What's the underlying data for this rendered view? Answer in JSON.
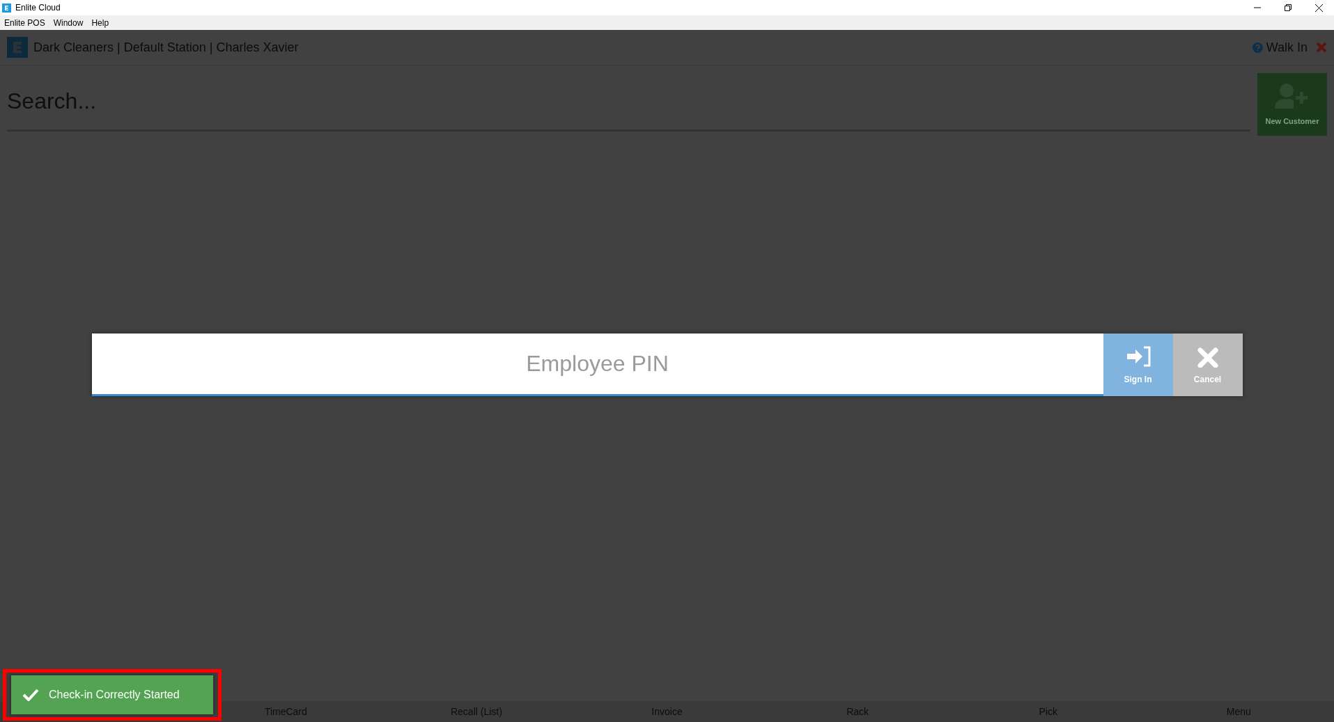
{
  "window": {
    "title": "Enlite Cloud"
  },
  "menu": [
    "Enlite POS",
    "Window",
    "Help"
  ],
  "header": {
    "title": "Dark Cleaners | Default Station | Charles Xavier",
    "customer": "Walk In"
  },
  "search": {
    "placeholder": "Search...",
    "new_customer": "New Customer"
  },
  "pin_dialog": {
    "placeholder": "Employee PIN",
    "buttons": [
      {
        "kind": "sign-in",
        "label": "Sign In"
      },
      {
        "kind": "cancel",
        "label": "Cancel"
      }
    ]
  },
  "nav": [
    "TimeCard",
    "Recall (List)",
    "Invoice",
    "Rack",
    "Pick",
    "Menu"
  ],
  "toast": {
    "message": "Check-in Correctly Started"
  }
}
